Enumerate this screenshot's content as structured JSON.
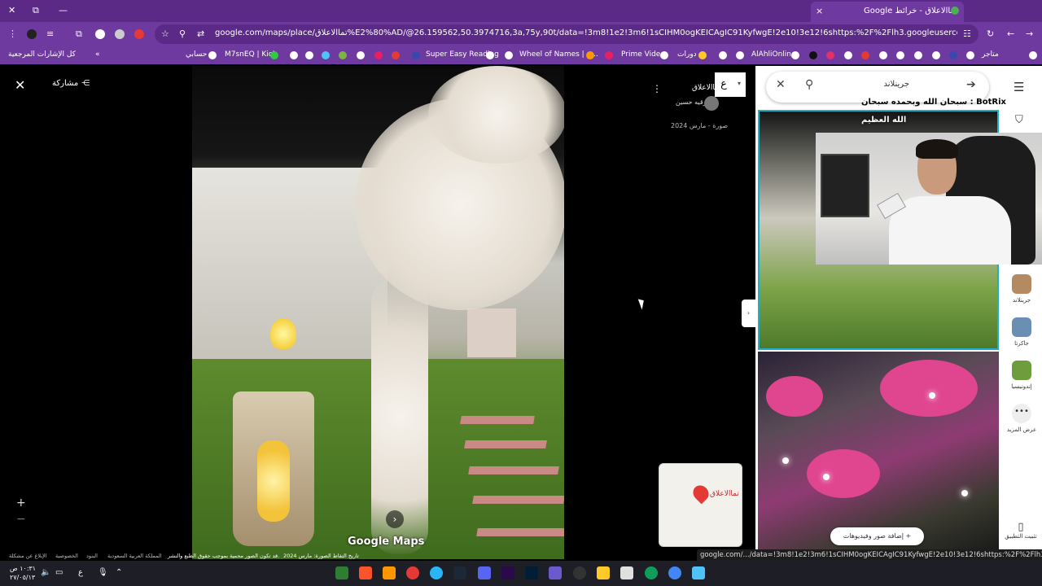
{
  "browser": {
    "tab_title": "تماالاعلاق - خرائط Google",
    "tab_close": "×",
    "new_tab": "+",
    "url": "google.com/maps/place/تماالاعلاق%E2%80%AD/@26.159562,50.3974716,3a,75y,90t/data=!3m8!1e2!3m6!1sCIHM0ogKEICAgIC91KyfwgE!2e10!3e12!6shttps:%2F%2Flh3.googleusercontent.com%2Fgps-cs-s%2FAG0ilSxR0Tf...",
    "status_url": "google.com/.../data=!3m8!1e2!3m6!1sCIHM0ogKEICAgIC91KyfwgE!2e10!3e12!6shttps:%2F%2Flh3.googleusercontent.con..."
  },
  "bookmarks": [
    {
      "label": "كل الإشارات المرجعية"
    },
    {
      "label": "حسابي"
    },
    {
      "label": "M7snEQ | Kick"
    },
    {
      "label": "Super Easy Reading"
    },
    {
      "label": "Wheel of Names | م..."
    },
    {
      "label": "Prime Video"
    },
    {
      "label": "دورات"
    },
    {
      "label": "AlAhliOnline"
    },
    {
      "label": "متاجر"
    }
  ],
  "viewer": {
    "share_label": "مشاركة",
    "watermark": "Google Maps",
    "zoom_in": "+",
    "zoom_out": "−",
    "next": "›"
  },
  "place": {
    "title": "تماالاعلاق",
    "badge_letter": "ع",
    "author": "رقيه حسين",
    "date": "صورة - مارس 2024"
  },
  "minimap": {
    "label": "تماالاعلاق"
  },
  "attribution": {
    "report": "الإبلاغ عن مشكلة",
    "privacy": "الخصوصية",
    "terms": "البنود",
    "country": "المملكة العربية السعودية",
    "copyright": "قد تكون الصور محمية بموجب حقوق الطبع والنشر.",
    "date_taken": "تاريخ التقاط الصورة: مارس 2024"
  },
  "search": {
    "value": "جرينلاند",
    "placeholder": "جرينلاند"
  },
  "rail": [
    {
      "label": "جرينلاند",
      "color": "#b48a62"
    },
    {
      "label": "جاكرتا",
      "color": "#6b8fb3"
    },
    {
      "label": "إندونيسيا",
      "color": "#6f9c3d"
    },
    {
      "label": "عرض المزيد",
      "color": "#eeeeee"
    }
  ],
  "panel": {
    "add_media": "إضافة صور وفيديوهات",
    "install_app": "تثبيت التطبيق"
  },
  "stream_overlay": {
    "line1": "سبحان الله وبحمده سبحان : BotRix",
    "line2": "الله العظيم"
  },
  "clock": {
    "time": "١٠:٣١ ص",
    "date": "٢٧/٠٥/١٣"
  },
  "taskbar_lang": "ع",
  "colors": {
    "chrome_purple": "#5b2a86",
    "toolbar_purple": "#6f3aa0",
    "highlight_border": "#1eb0c8",
    "taskbar": "#1e1f26"
  }
}
